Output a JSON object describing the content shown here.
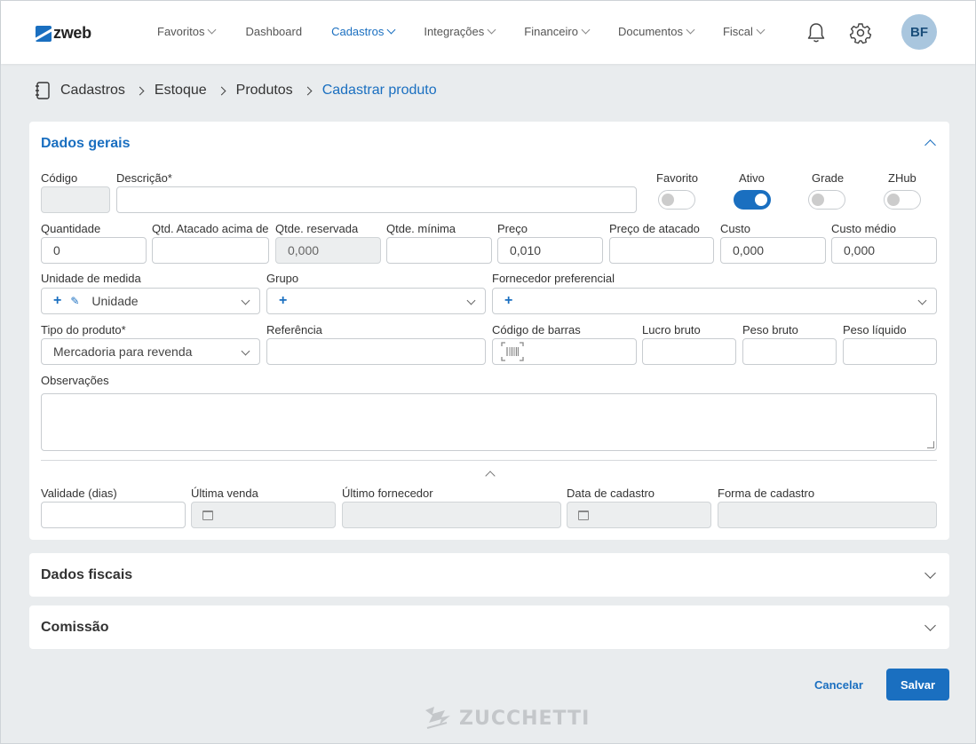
{
  "brand": {
    "name": "zweb",
    "accent": "#1a6fc0"
  },
  "nav": {
    "items": [
      {
        "label": "Favoritos",
        "dropdown": true,
        "active": false
      },
      {
        "label": "Dashboard",
        "dropdown": false,
        "active": false
      },
      {
        "label": "Cadastros",
        "dropdown": true,
        "active": true
      },
      {
        "label": "Integrações",
        "dropdown": true,
        "active": false
      },
      {
        "label": "Financeiro",
        "dropdown": true,
        "active": false
      },
      {
        "label": "Documentos",
        "dropdown": true,
        "active": false
      },
      {
        "label": "Fiscal",
        "dropdown": true,
        "active": false
      }
    ],
    "avatar_initials": "BF"
  },
  "breadcrumb": [
    "Cadastros",
    "Estoque",
    "Produtos",
    "Cadastrar produto"
  ],
  "sections": {
    "general_title": "Dados gerais",
    "fiscal_title": "Dados fiscais",
    "commission_title": "Comissão"
  },
  "form": {
    "codigo": {
      "label": "Código",
      "value": ""
    },
    "descricao": {
      "label": "Descrição*",
      "value": ""
    },
    "toggles": [
      {
        "label": "Favorito",
        "on": false
      },
      {
        "label": "Ativo",
        "on": true
      },
      {
        "label": "Grade",
        "on": false
      },
      {
        "label": "ZHub",
        "on": false
      }
    ],
    "quantidade": {
      "label": "Quantidade",
      "value": "0"
    },
    "qtd_atacado": {
      "label": "Qtd. Atacado acima de",
      "value": ""
    },
    "qtde_reservada": {
      "label": "Qtde. reservada",
      "value": "0,000"
    },
    "qtde_minima": {
      "label": "Qtde. mínima",
      "value": ""
    },
    "preco": {
      "label": "Preço",
      "value": "0,010"
    },
    "preco_atacado": {
      "label": "Preço de atacado",
      "value": ""
    },
    "custo": {
      "label": "Custo",
      "value": "0,000"
    },
    "custo_medio": {
      "label": "Custo médio",
      "value": "0,000"
    },
    "unidade": {
      "label": "Unidade de medida",
      "value": "Unidade"
    },
    "grupo": {
      "label": "Grupo",
      "value": ""
    },
    "fornecedor": {
      "label": "Fornecedor preferencial",
      "value": ""
    },
    "tipo_produto": {
      "label": "Tipo do produto*",
      "value": "Mercadoria para revenda"
    },
    "referencia": {
      "label": "Referência",
      "value": ""
    },
    "codigo_barras": {
      "label": "Código de barras",
      "value": ""
    },
    "lucro_bruto": {
      "label": "Lucro bruto",
      "value": ""
    },
    "peso_bruto": {
      "label": "Peso bruto",
      "value": ""
    },
    "peso_liquido": {
      "label": "Peso líquido",
      "value": ""
    },
    "observacoes": {
      "label": "Observações",
      "value": ""
    },
    "validade": {
      "label": "Validade (dias)",
      "value": ""
    },
    "ultima_venda": {
      "label": "Última venda",
      "value": ""
    },
    "ultimo_fornecedor": {
      "label": "Último fornecedor",
      "value": ""
    },
    "data_cadastro": {
      "label": "Data de cadastro",
      "value": ""
    },
    "forma_cadastro": {
      "label": "Forma de cadastro",
      "value": ""
    }
  },
  "actions": {
    "cancel": "Cancelar",
    "save": "Salvar"
  },
  "footer": {
    "brand": "ZUCCHETTI"
  }
}
